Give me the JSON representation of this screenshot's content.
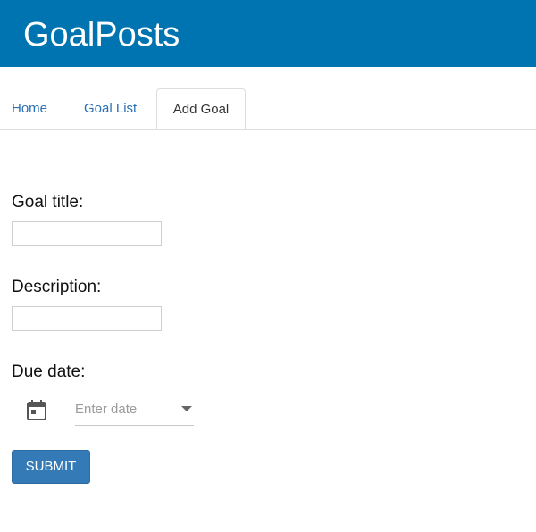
{
  "app": {
    "title": "GoalPosts"
  },
  "nav": {
    "tabs": [
      {
        "label": "Home",
        "active": false
      },
      {
        "label": "Goal List",
        "active": false
      },
      {
        "label": "Add Goal",
        "active": true
      }
    ]
  },
  "form": {
    "goal_title": {
      "label": "Goal title:",
      "value": "",
      "placeholder": ""
    },
    "description": {
      "label": "Description:",
      "value": "",
      "placeholder": ""
    },
    "due_date": {
      "label": "Due date:",
      "placeholder": "Enter date",
      "icon": "calendar-icon"
    },
    "submit_label": "SUBMIT"
  },
  "colors": {
    "header_bg": "#0074b1",
    "link": "#2b6fb4",
    "button_bg": "#337ab7"
  }
}
